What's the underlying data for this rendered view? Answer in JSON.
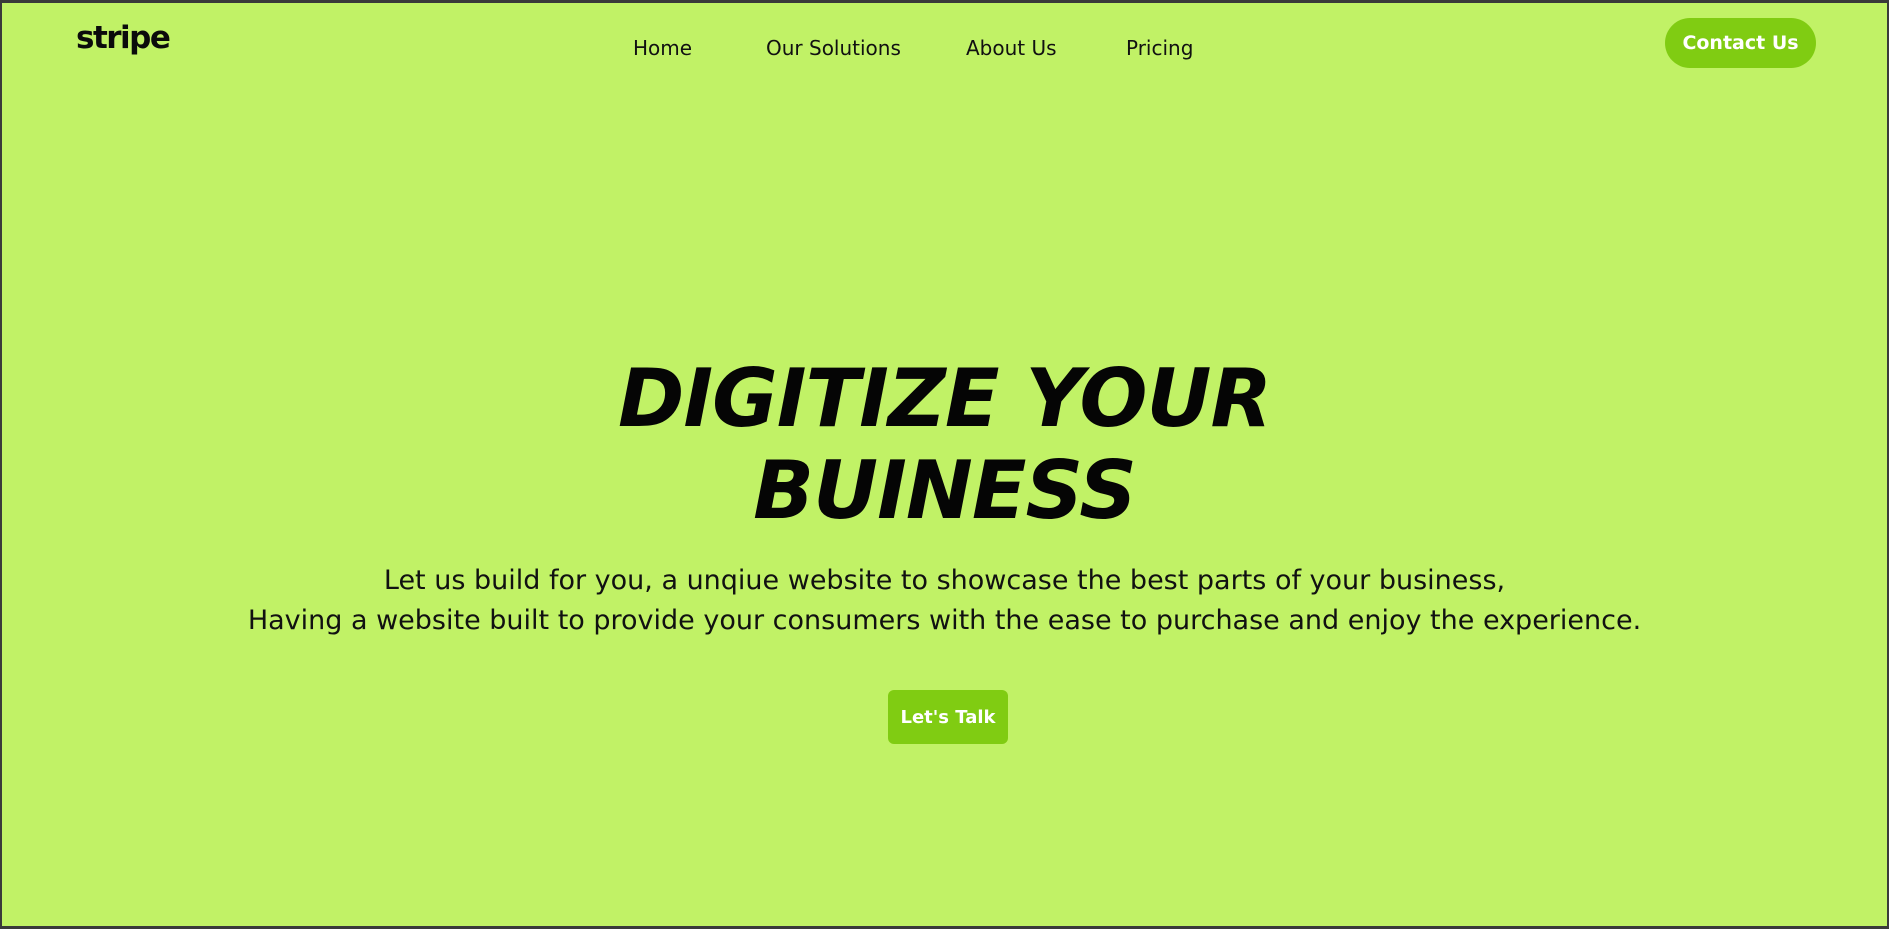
{
  "brand": {
    "logo_text": "stripe"
  },
  "nav": {
    "items": [
      {
        "label": "Home"
      },
      {
        "label": "Our Solutions"
      },
      {
        "label": "About Us"
      },
      {
        "label": "Pricing"
      }
    ],
    "contact_label": "Contact Us"
  },
  "hero": {
    "title_line1": "DIGITIZE YOUR",
    "title_line2": "BUINESS",
    "subtitle_line1": "Let us build for you, a unqiue website to showcase the best parts of your business,",
    "subtitle_line2": "Having a website built to provide your consumers with the ease to purchase and enjoy the experience.",
    "cta_label": "Let's Talk"
  },
  "colors": {
    "background": "#c1f266",
    "accent": "#80cc12",
    "text": "#0b0b0b"
  }
}
